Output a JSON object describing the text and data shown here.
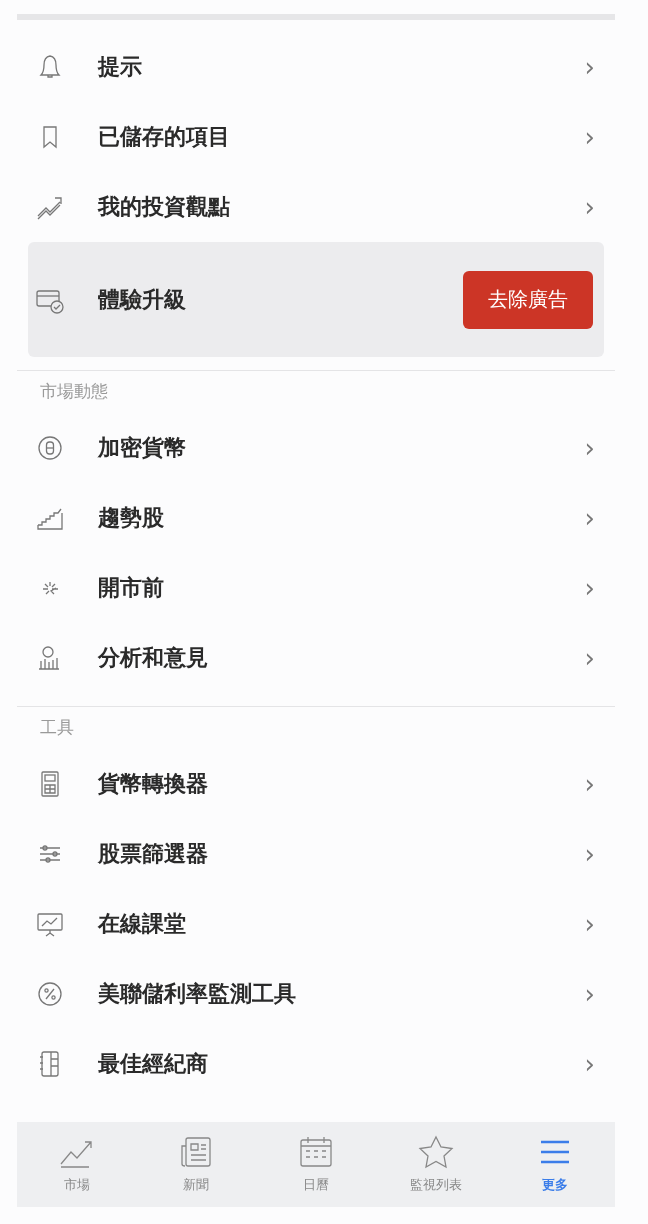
{
  "top_items": [
    {
      "label": "提示"
    },
    {
      "label": "已儲存的項目"
    },
    {
      "label": "我的投資觀點"
    }
  ],
  "upgrade": {
    "label": "體驗升級",
    "button": "去除廣告"
  },
  "sections": [
    {
      "title": "市場動態",
      "items": [
        {
          "label": "加密貨幣"
        },
        {
          "label": "趨勢股"
        },
        {
          "label": "開市前"
        },
        {
          "label": "分析和意見"
        }
      ]
    },
    {
      "title": "工具",
      "items": [
        {
          "label": "貨幣轉換器"
        },
        {
          "label": "股票篩選器"
        },
        {
          "label": "在線課堂"
        },
        {
          "label": "美聯儲利率監測工具"
        },
        {
          "label": "最佳經紀商"
        }
      ]
    }
  ],
  "chevron": "›",
  "nav": [
    {
      "label": "市場",
      "selected": false
    },
    {
      "label": "新聞",
      "selected": false
    },
    {
      "label": "日曆",
      "selected": false
    },
    {
      "label": "監視列表",
      "selected": false
    },
    {
      "label": "更多",
      "selected": true
    }
  ]
}
